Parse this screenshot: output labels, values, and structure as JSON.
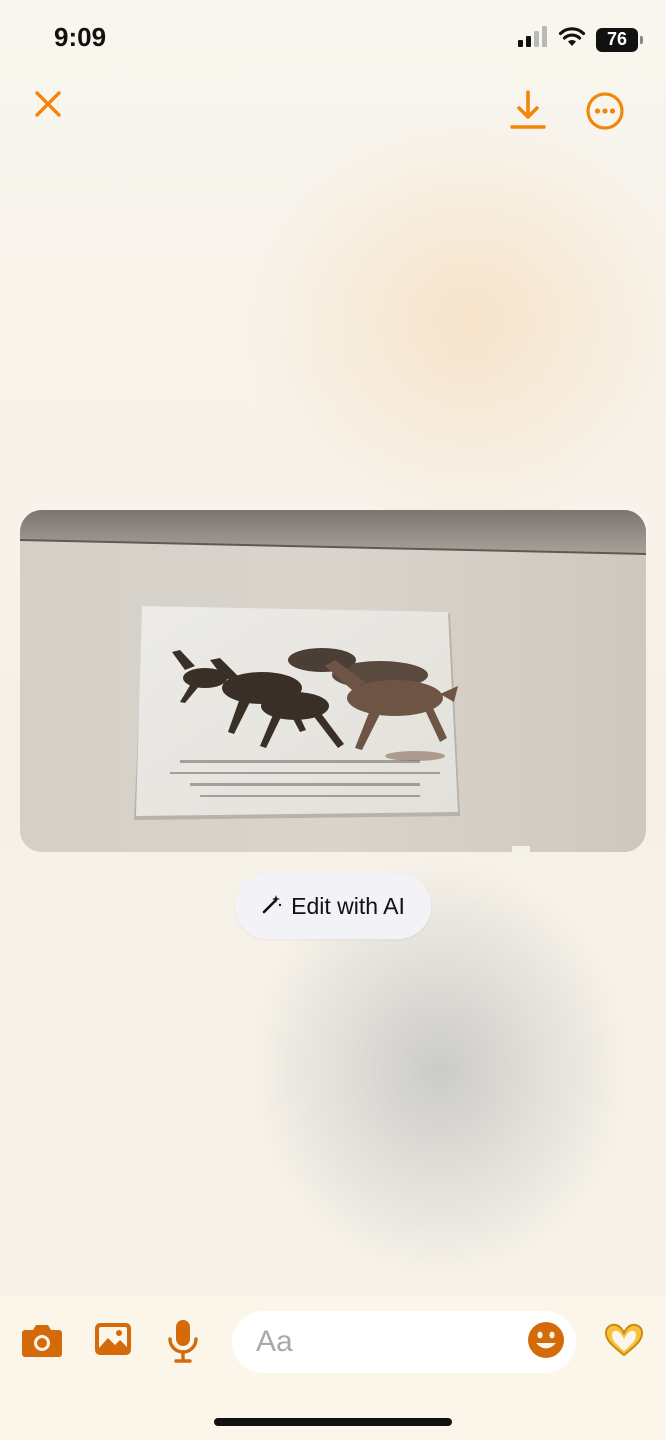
{
  "status_bar": {
    "time": "9:09",
    "battery": "76",
    "icons": [
      "signal-icon",
      "wifi-icon",
      "battery-icon"
    ]
  },
  "top_bar": {
    "icons": [
      "close-icon",
      "download-icon",
      "more-options-icon"
    ],
    "accent_color": "#f2860b"
  },
  "media": {
    "description_icon": "photo-viewer"
  },
  "edit_ai": {
    "label": "Edit with AI",
    "icon": "magic-wand-icon"
  },
  "composer": {
    "placeholder": "Aa",
    "icons": [
      "camera-icon",
      "gallery-icon",
      "microphone-icon",
      "emoji-icon",
      "heart-hands-icon"
    ],
    "icon_color": "#d46a0a",
    "background": "#fbf6e9"
  }
}
